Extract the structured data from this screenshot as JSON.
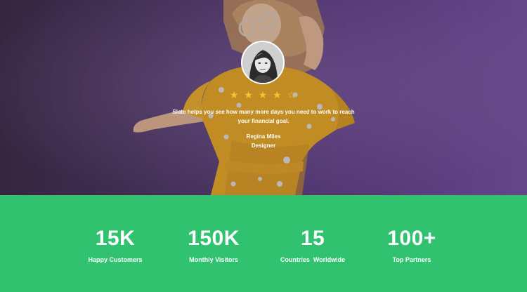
{
  "colors": {
    "hero_gradient_start": "#3b2a45",
    "hero_gradient_end": "#74529e",
    "stats_background": "#31c270",
    "star_color": "#f4c430",
    "text": "#ffffff"
  },
  "testimonial": {
    "rating": 4,
    "rating_max": 5,
    "star_filled": "★",
    "star_empty": "☆",
    "quote": "Slate helps you see how many more days you need to work to reach your financial goal.",
    "author_name": "Regina Miles",
    "author_role": "Designer"
  },
  "stats": [
    {
      "value": "15K",
      "label": "Happy Customers"
    },
    {
      "value": "150K",
      "label": "Monthly Visitors"
    },
    {
      "value": "15",
      "label": "Countries  Worldwide"
    },
    {
      "value": "100+",
      "label": "Top Partners"
    }
  ]
}
